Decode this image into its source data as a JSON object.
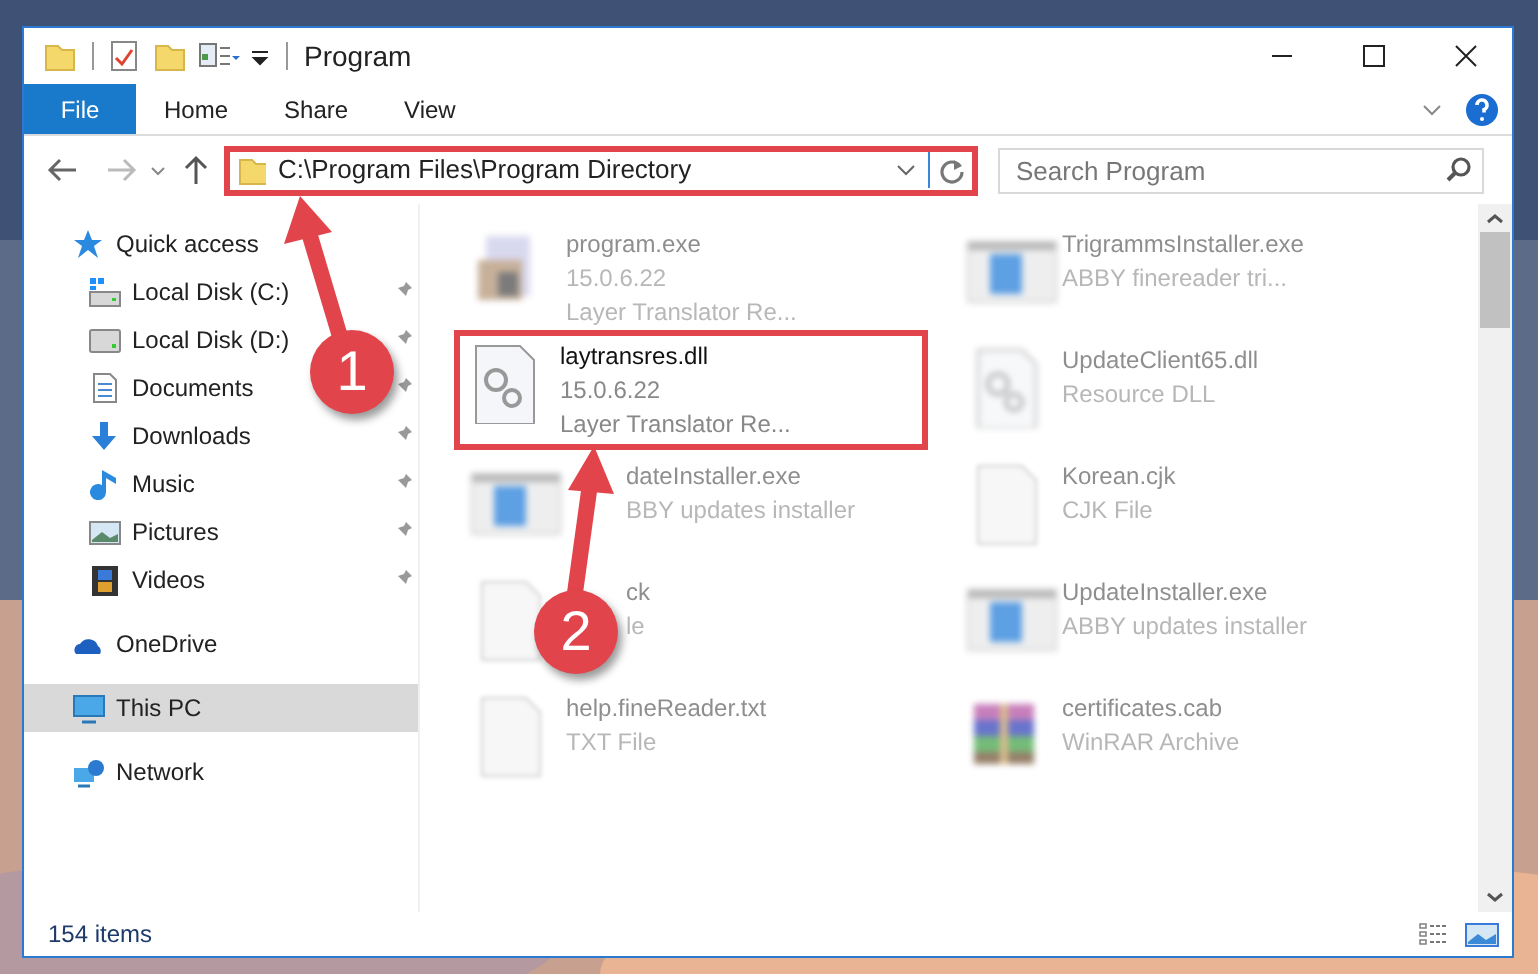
{
  "window": {
    "title": "Program"
  },
  "ribbon": {
    "tabs": [
      {
        "label": "File",
        "kind": "file"
      },
      {
        "label": "Home",
        "kind": "tab"
      },
      {
        "label": "Share",
        "kind": "tab"
      },
      {
        "label": "View",
        "kind": "tab"
      }
    ]
  },
  "address": {
    "path": "C:\\Program Files\\Program Directory",
    "highlighted": true
  },
  "search": {
    "placeholder": "Search Program"
  },
  "nav": [
    {
      "label": "Quick access",
      "kind": "star",
      "pinned": false,
      "selected": false,
      "children": [
        {
          "label": "Local Disk (C:)",
          "kind": "system_drive",
          "pinned": true,
          "selected": false
        },
        {
          "label": "Local Disk (D:)",
          "kind": "drive",
          "pinned": true,
          "selected": false
        },
        {
          "label": "Documents",
          "kind": "documents",
          "pinned": true,
          "selected": false
        },
        {
          "label": "Downloads",
          "kind": "downloads",
          "pinned": true,
          "selected": false
        },
        {
          "label": "Music",
          "kind": "music",
          "pinned": true,
          "selected": false
        },
        {
          "label": "Pictures",
          "kind": "pictures",
          "pinned": true,
          "selected": false
        },
        {
          "label": "Videos",
          "kind": "videos",
          "pinned": true,
          "selected": false
        }
      ]
    },
    {
      "label": "OneDrive",
      "kind": "cloud",
      "pinned": false,
      "selected": false
    },
    {
      "label": "This PC",
      "kind": "pc",
      "pinned": false,
      "selected": true
    },
    {
      "label": "Network",
      "kind": "network",
      "pinned": false,
      "selected": false
    }
  ],
  "files": [
    {
      "name": "program.exe",
      "line_2": "15.0.6.22",
      "line_3": "Layer Translator Re...",
      "kind": "exe",
      "blurred": true,
      "highlighted": false,
      "covered": false
    },
    {
      "name": "TrigrammsInstaller.exe",
      "line_2": "ABBY finereader tri...",
      "kind": "installer",
      "blurred": true,
      "highlighted": false,
      "covered": false
    },
    {
      "name": "laytransres.dll",
      "line_2": "15.0.6.22",
      "line_3": "Layer Translator Re...",
      "kind": "dll",
      "blurred": false,
      "highlighted": true,
      "covered": false
    },
    {
      "name": "UpdateClient65.dll",
      "line_2": "Resource DLL",
      "kind": "dll",
      "blurred": true,
      "highlighted": false,
      "covered": false
    },
    {
      "name": "dateInstaller.exe",
      "line_2": "BBY updates installer",
      "kind": "installer",
      "blurred": true,
      "highlighted": false,
      "covered": true
    },
    {
      "name": "Korean.cjk",
      "line_2": "CJK File",
      "kind": "blank",
      "blurred": true,
      "highlighted": false,
      "covered": false
    },
    {
      "name": "ck",
      "line_2": "le",
      "kind": "blank",
      "blurred": true,
      "highlighted": false,
      "covered": true
    },
    {
      "name": "UpdateInstaller.exe",
      "line_2": "ABBY updates installer",
      "kind": "installer",
      "blurred": true,
      "highlighted": false,
      "covered": false
    },
    {
      "name": "help.fineReader.txt",
      "line_2": "TXT File",
      "kind": "blank",
      "blurred": true,
      "highlighted": false,
      "covered": false
    },
    {
      "name": "certificates.cab",
      "line_2": "WinRAR Archive",
      "kind": "archive",
      "blurred": true,
      "highlighted": false,
      "covered": false
    }
  ],
  "callouts": [
    {
      "label": "1"
    },
    {
      "label": "2"
    }
  ],
  "status_bar": {
    "item_count": "154 items"
  }
}
